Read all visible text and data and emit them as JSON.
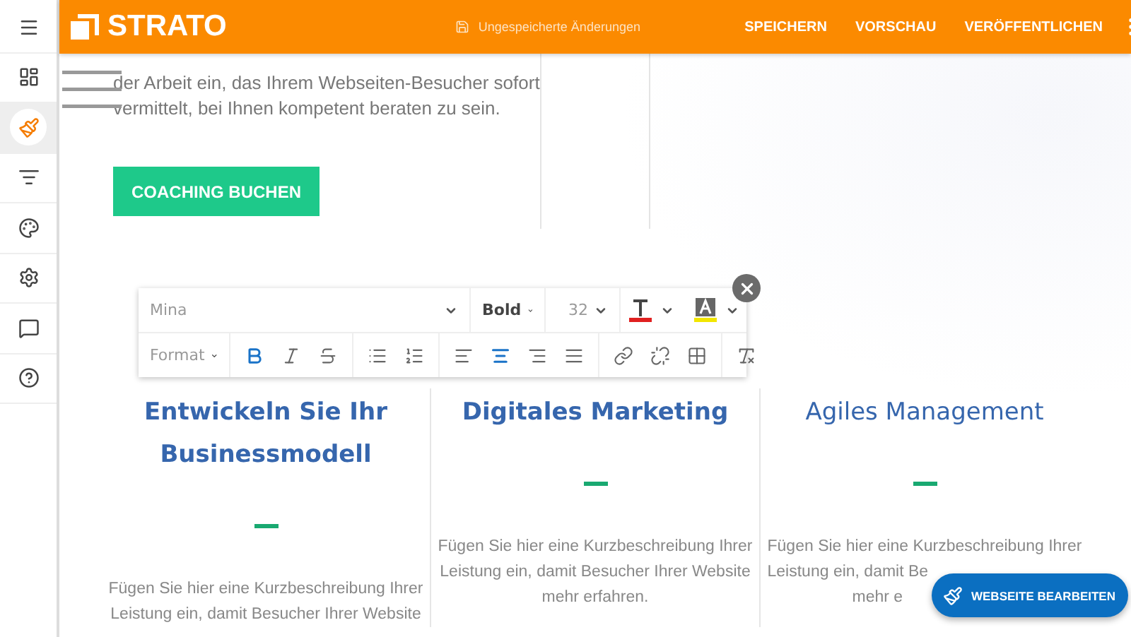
{
  "sidebar": {
    "items": [
      {
        "kind": "menu",
        "selected": false
      },
      {
        "kind": "dashboard",
        "selected": false
      },
      {
        "kind": "design",
        "selected": true
      },
      {
        "kind": "sort",
        "selected": false
      },
      {
        "kind": "palette",
        "selected": false
      },
      {
        "kind": "settings",
        "selected": false
      },
      {
        "kind": "chat",
        "selected": false
      },
      {
        "kind": "help",
        "selected": false
      }
    ]
  },
  "header": {
    "logo": "STRATO",
    "status": "Ungespeicherte Änderungen",
    "actions": [
      "SPEICHERN",
      "VORSCHAU",
      "VERÖFFENTLICHEN"
    ]
  },
  "intro": {
    "lines": [
      "der Arbeit ein, das Ihrem Webseiten-Besucher sofort",
      "vermittelt, bei Ihnen kompetent beraten zu sein."
    ],
    "button": "COACHING BUCHEN"
  },
  "editor_toolbar": {
    "font": "Mina",
    "weight": "Bold",
    "size": "32",
    "format": "Format",
    "groups": [
      [
        {
          "kind": "bold",
          "selected": true
        },
        {
          "kind": "italic",
          "selected": false
        },
        {
          "kind": "strike",
          "selected": false
        }
      ],
      [
        {
          "kind": "bullets",
          "selected": false
        },
        {
          "kind": "numbers",
          "selected": false
        }
      ],
      [
        {
          "kind": "align-left",
          "selected": false
        },
        {
          "kind": "align-center",
          "selected": true
        },
        {
          "kind": "align-right",
          "selected": false
        },
        {
          "kind": "justify",
          "selected": false
        }
      ],
      [
        {
          "kind": "link",
          "selected": false
        },
        {
          "kind": "unlink",
          "selected": false
        },
        {
          "kind": "table",
          "selected": false
        }
      ],
      [
        {
          "kind": "clear",
          "selected": false
        }
      ]
    ]
  },
  "services": [
    {
      "title": [
        "Entwickeln Sie Ihr",
        "Businessmodell"
      ],
      "light": false,
      "lines": [
        "Fügen Sie hier eine Kurzbeschreibung Ihrer",
        "Leistung ein, damit Besucher Ihrer Website"
      ]
    },
    {
      "title": [
        "Digitales Marketing"
      ],
      "light": false,
      "lines": [
        "Fügen Sie hier eine Kurzbeschreibung Ihrer",
        "Leistung ein, damit Besucher Ihrer Website",
        "mehr erfahren."
      ]
    },
    {
      "title": [
        "Agiles Management"
      ],
      "light": true,
      "covered": true,
      "lines": [
        "Fügen Sie hier eine Kurzbeschreibung Ihrer",
        "Leistung ein, damit Be",
        "mehr e"
      ]
    }
  ],
  "fab": {
    "label": "WEBSEITE BEARBEITEN"
  }
}
